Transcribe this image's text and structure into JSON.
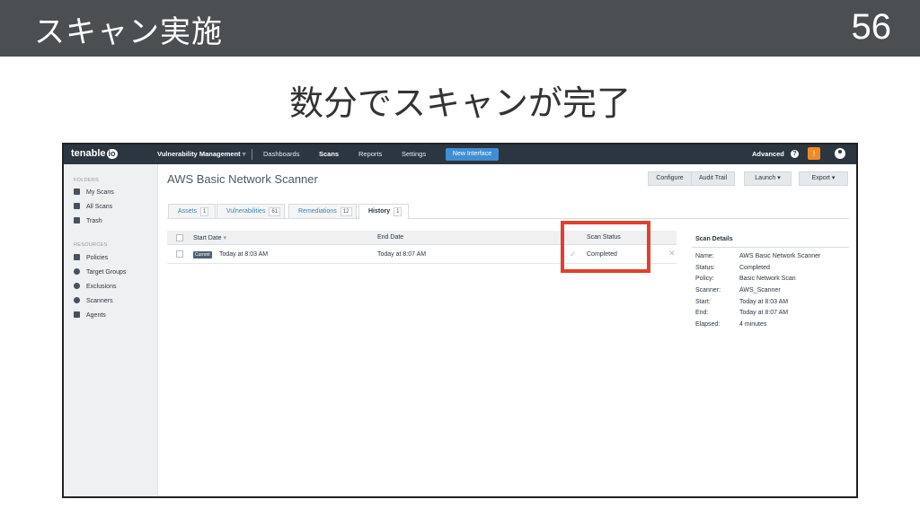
{
  "slide": {
    "title": "スキャン実施",
    "number": "56",
    "subtitle": "数分でスキャンが完了"
  },
  "app": {
    "logo": "tenable",
    "logo_suffix": "io",
    "nav": {
      "module": "Vulnerability Management",
      "module_caret": "▾",
      "items": [
        "Dashboards",
        "Scans",
        "Reports",
        "Settings"
      ],
      "active": "Scans",
      "new_interface": "New Interface",
      "advanced": "Advanced",
      "help": "?",
      "alert": "!"
    },
    "sidebar": {
      "folders_heading": "FOLDERS",
      "folders": [
        "My Scans",
        "All Scans",
        "Trash"
      ],
      "resources_heading": "RESOURCES",
      "resources": [
        "Policies",
        "Target Groups",
        "Exclusions",
        "Scanners",
        "Agents"
      ]
    },
    "scan_title": "AWS Basic Network Scanner",
    "toolbar": {
      "configure": "Configure",
      "audit_trail": "Audit Trail",
      "launch": "Launch",
      "export": "Export",
      "caret": "▾"
    },
    "tabs": [
      {
        "label": "Assets",
        "count": "1"
      },
      {
        "label": "Vulnerabilities",
        "count": "61"
      },
      {
        "label": "Remediations",
        "count": "12"
      },
      {
        "label": "History",
        "count": "1"
      }
    ],
    "table": {
      "headers": {
        "start": "Start Date",
        "sort_caret": "▾",
        "end": "End Date",
        "status": "Scan Status"
      },
      "rows": [
        {
          "badge": "Current",
          "start": "Today at 8:03 AM",
          "end": "Today at 8:07 AM",
          "status": "Completed"
        }
      ]
    },
    "details": {
      "title": "Scan Details",
      "fields": [
        {
          "label": "Name:",
          "value": "AWS Basic Network Scanner"
        },
        {
          "label": "Status:",
          "value": "Completed"
        },
        {
          "label": "Policy:",
          "value": "Basic Network Scan"
        },
        {
          "label": "Scanner:",
          "value": "AWS_Scanner"
        },
        {
          "label": "Start:",
          "value": "Today at 8:03 AM"
        },
        {
          "label": "End:",
          "value": "Today at 8:07 AM"
        },
        {
          "label": "Elapsed:",
          "value": "4 minutes"
        }
      ]
    }
  },
  "colors": {
    "header_bg": "#4b4f51",
    "nav_bg": "#2b3640",
    "accent": "#3f8ed4",
    "highlight": "#e0412c",
    "alert": "#f08a24"
  }
}
